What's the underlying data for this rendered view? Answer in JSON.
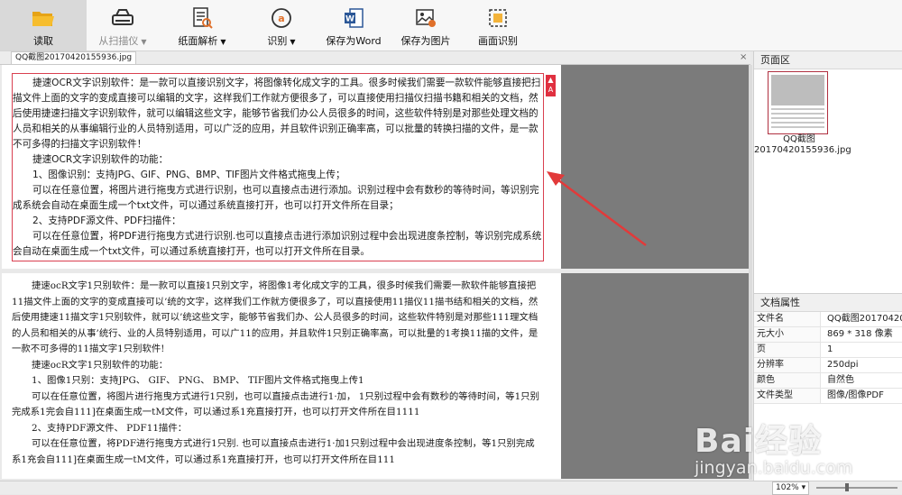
{
  "toolbar": {
    "read": "读取",
    "scanner": "从扫描仪",
    "parse": "纸面解析",
    "recognize": "识别",
    "save_word": "保存为Word",
    "save_image": "保存为图片",
    "screen_recognize": "画面识别"
  },
  "tab": {
    "name": "QQ截图20170420155936.jpg",
    "close": "×"
  },
  "source_text": [
    "捷速OCR文字识别软件：是一款可以直接识别文字，将图像转化成文字的工具。很多时候我们需要一款软件能够直接把扫描文件上面的文字的变成直接可以编辑的文字，这样我们工作就方便很多了，可以直接使用扫描仪扫描书籍和相关的文档，然后使用捷速扫描文字识别软件，就可以编辑这些文字，能够节省我们办公人员很多的时间，这些软件特别是对那些处理文档的人员和相关的从事编辑行业的人员特别适用，可以广泛的应用，并且软件识别正确率高，可以批量的转换扫描的文件，是一款不可多得的扫描文字识别软件！",
    "捷速OCR文字识别软件的功能：",
    "1、图像识别：支持JPG、GIF、PNG、BMP、TIF图片文件格式拖曳上传；",
    "可以在任意位置，将图片进行拖曳方式进行识别，也可以直接点击进行添加。识别过程中会有数秒的等待时间，等识别完成系统会自动在桌面生成一个txt文件，可以通过系统直接打开，也可以打开文件所在目录；",
    "2、支持PDF源文件、PDF扫描件：",
    "可以在任意位置，将PDF进行拖曳方式进行识别.也可以直接点击进行添加识别过程中会出现进度条控制，等识别完成系统会自动在桌面生成一个txt文件，可以通过系统直接打开，也可以打开文件所在目录。"
  ],
  "ocr_text": [
    "捷速ocR文字1只别软件：是一款可以直接1只别文字，将图像1考化成文字的工具，很多时候我们需要一款软件能够直接把11描文件上面的文字的变成直接可以’统的文字，这样我们工作就方便很多了，可以直接使用11描仪11描书结和相关的文档，然后使用捷速11描文字1只别软件，就可以’统这些文字，能够节省我们办、公人员很多的时间，这些软件特别是对那些111理文档的人员和相关的从事’统行、业的人员特别适用，可以广11的应用，并且软件1只别正确率高，可以批量的1考换11描的文件，是一款不可多得的11描文字1只别软件!",
    "捷速ocR文字1只别软件的功能：",
    "1、图像1只别：支持JPG、 GIF、 PNG、 BMP、 TIF图片文件格式拖曳上传1",
    "可以在任意位置，将图片进行拖曳方式进行1只别，也可以直接点击进行1·加， 1只别过程中会有数秒的等待时间，等1只别完成系1完会自111]在桌面生成一tM文件，可以通过系1充直接打开，也可以打开文件所在目1111",
    "2、支持PDF源文件、 PDF11描件：",
    "可以在任意位置，将PDF进行拖曳方式进行1只别. 也可以直接点击进行1·加1只别过程中会出现进度条控制，等1只别完成系1充会自111]在桌面生成一tM文件，可以通过系1充直接打开，也可以打开文件所在目111"
  ],
  "pages_panel": {
    "title": "页面区",
    "thumb_name_line1": "QQ截图",
    "thumb_name_line2": "20170420155936.jpg"
  },
  "props": {
    "title": "文档属性",
    "rows": [
      {
        "k": "文件名",
        "v": "QQ截图20170420..."
      },
      {
        "k": "元大小",
        "v": "869 * 318 像素"
      },
      {
        "k": "页",
        "v": "1"
      },
      {
        "k": "分辨率",
        "v": "250dpi"
      },
      {
        "k": "颜色",
        "v": "自然色"
      },
      {
        "k": "文件类型",
        "v": "图像/图像PDF"
      }
    ]
  },
  "status": {
    "zoom": "102%"
  },
  "watermark": {
    "main": "Bai经验",
    "sub": "jingyan.baidu.com"
  },
  "colors": {
    "accent_red": "#d94050",
    "arrow": "#e23a3a",
    "active_tab": "#d9d9d9"
  }
}
